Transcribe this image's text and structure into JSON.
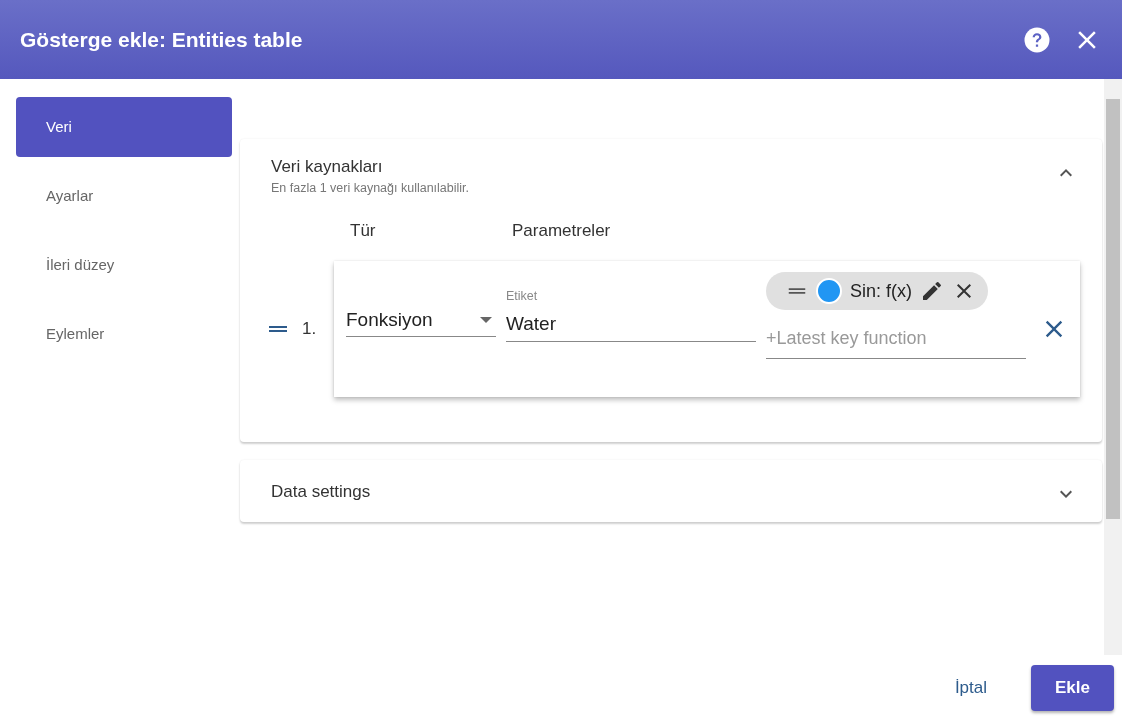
{
  "dialog": {
    "title": "Gösterge ekle: Entities table"
  },
  "sidebar": {
    "items": [
      {
        "label": "Veri",
        "selected": true
      },
      {
        "label": "Ayarlar",
        "selected": false
      },
      {
        "label": "İleri düzey",
        "selected": false
      },
      {
        "label": "Eylemler",
        "selected": false
      }
    ]
  },
  "panels": [
    {
      "title": "Veri kaynakları",
      "subtitle": "En fazla 1 veri kaynağı kullanılabilir.",
      "expanded": true,
      "columns": [
        "Tür",
        "Parametreler"
      ],
      "datasources": [
        {
          "index": "1.",
          "type": "Fonksiyon",
          "label_caption": "Etiket",
          "label_value": "Water",
          "keys": [
            {
              "label": "Sin: f(x)",
              "color": "#2196f3"
            }
          ],
          "key_placeholder": "+Latest key function"
        }
      ]
    },
    {
      "title": "Data settings",
      "expanded": false
    }
  ],
  "buttons": [
    {
      "label": "İptal",
      "kind": "text"
    },
    {
      "label": "Ekle",
      "kind": "raised"
    }
  ]
}
